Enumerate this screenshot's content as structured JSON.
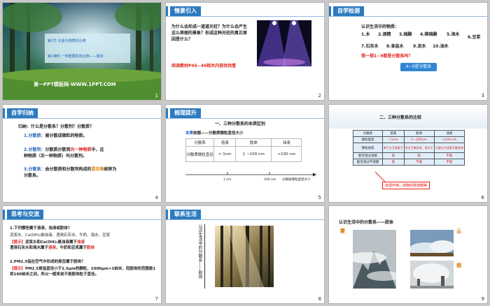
{
  "slides": [
    {
      "num": "1",
      "section": "第1节  元素与物质的分类",
      "lesson": "第2课时  一种重要的混合物——胶体",
      "footer": "第一PPT模板网-WWW.1PPT.COM"
    },
    {
      "num": "2",
      "tag": "情景引入",
      "question": "为什么会形成一道道光柱？为什么会产生这么美丽的景象？形成这种光柱的真正原因是什么？",
      "reading": "阅读教材P45~46相关内容找找看"
    },
    {
      "num": "3",
      "tag": "自学检测",
      "intro": "认识生活中的物质：",
      "items": [
        "1.水",
        "2.酒精",
        "3.硫酸",
        "4.稀硫酸",
        "5.海水",
        "6.豆浆",
        "7.石灰水",
        "8.食盐水",
        "9.泥水",
        "10.油水"
      ],
      "prompt": "想一想1~9都是分散系吗？",
      "button": "4~9是分散系"
    },
    {
      "num": "4",
      "tag": "自学归纳",
      "q": "归纳：什么是分散系？分散剂？分散质？",
      "p1_label": "1.分散质：",
      "p1_text": "被分散成微粒的物质。",
      "p2_label": "2.分散剂：",
      "p2_text_a": "分散质分散到",
      "p2_text_b": "另一种物质",
      "p2_text_c": "中，这种物质（另一种物质）叫分散剂。",
      "p3_label": "3.分散系：",
      "p3_text_a": "由分散质和分散剂构成的",
      "p3_text_b": "混合物",
      "p3_text_c": "统称为分散系。"
    },
    {
      "num": "5",
      "tag": "梳理提升",
      "heading": "一、三种分散系的本质区别",
      "basis_a": "本质",
      "basis_b": "依据——分散质微粒直径大小",
      "cols": [
        "分散系",
        "溶液",
        "胶体",
        "浊液"
      ],
      "row_label": "分散质微粒直径",
      "row_values": [
        "< 1nm",
        "1 ~100 nm",
        ">100 nm"
      ],
      "axis_1": "1 nm",
      "axis_2": "100 nm",
      "axis_caption": "分散质微粒直径大小"
    },
    {
      "num": "6",
      "heading": "二、三种分散系的比较",
      "cols": [
        "分散系",
        "溶液",
        "胶体",
        "浊液"
      ],
      "rows": [
        [
          "微粒直径",
          "<1nm",
          "1~100nm",
          ">100 nm"
        ],
        [
          "微粒组成",
          "单个分子或离子",
          "多分子集合体、高分子",
          "大量分子或离子集合体"
        ],
        [
          "能否透过滤纸",
          "能",
          "能",
          "不能"
        ],
        [
          "能否透过半透膜",
          "能",
          "不能",
          "不能"
        ]
      ],
      "note": "渗透作用、动物的排泄膜等"
    },
    {
      "num": "7",
      "tag": "思考与交流",
      "q1": "1.下列哪些属于溶液、浊液或胶体？",
      "q1_list": "泥浆水、Ca(OH)₂悬浊液、澄清石灰水、牛奶、海水、豆浆",
      "hint1_label": "【提示】",
      "hint1_a": "泥浆水和Ca(OH)₂悬浊液属于",
      "hint1_b": "浊液",
      "hint1_c": "澄清石灰水和海水属于",
      "hint1_d": "溶液",
      "hint1_e": "，牛奶和豆浆属于",
      "hint1_f": "胶体",
      "q2": "2.PM2.5指在空气中形成的是否属于胶体？",
      "hint2_label": "【提示】",
      "hint2_text": "PM2.5是指直径小于2.5μm的颗粒，1000μm=1纳米，而胶体的范围是1到100纳米之间，所以一般来说不是胶体粒子直径。"
    },
    {
      "num": "8",
      "tag": "联系生活",
      "vertical": "认识生活中的分散系——胶体"
    },
    {
      "num": "9",
      "title": "认识生活中的分散系——胶体",
      "w1": "雾",
      "w2": "云",
      "w3": "烟"
    }
  ]
}
